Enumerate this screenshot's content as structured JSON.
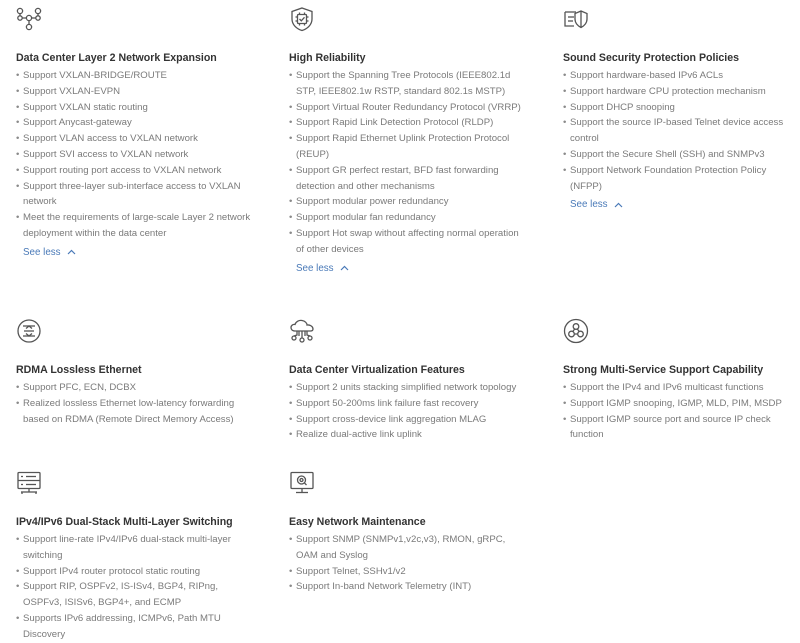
{
  "colors": {
    "title": "#333333",
    "text": "#7a7a7a",
    "link": "#4a7ab8",
    "icon": "#555555"
  },
  "features": [
    {
      "icon": "network-topology-icon",
      "title": "Data Center Layer 2 Network Expansion",
      "items": [
        "Support VXLAN-BRIDGE/ROUTE",
        "Support VXLAN-EVPN",
        "Support VXLAN static routing",
        "Support Anycast-gateway",
        "Support VLAN access to VXLAN network",
        "Support SVI access to VXLAN network",
        "Support routing port access to VXLAN network",
        "Support three-layer sub-interface access to VXLAN network",
        "Meet the requirements of large-scale Layer 2 network deployment within the data center"
      ],
      "toggle": "See less"
    },
    {
      "icon": "shield-chip-icon",
      "title": "High Reliability",
      "items": [
        "Support the Spanning Tree Protocols (IEEE802.1d STP, IEEE802.1w RSTP, standard 802.1s MSTP)",
        "Support Virtual Router Redundancy Protocol (VRRP)",
        "Support Rapid Link Detection Protocol (RLDP)",
        "Support Rapid Ethernet Uplink Protection Protocol (REUP)",
        "Support GR perfect restart, BFD fast forwarding detection and other mechanisms",
        "Support modular power redundancy",
        "Support modular fan redundancy",
        "Support Hot swap without affecting normal operation of other devices"
      ],
      "toggle": "See less"
    },
    {
      "icon": "security-policy-icon",
      "title": "Sound Security Protection Policies",
      "items": [
        "Support hardware-based IPv6 ACLs",
        "Support hardware CPU protection mechanism",
        "Support DHCP snooping",
        "Support the source IP-based Telnet device access control",
        "Support the Secure Shell (SSH) and SNMPv3",
        "Support Network Foundation Protection Policy (NFPP)"
      ],
      "toggle": "See less"
    },
    {
      "icon": "lossless-ethernet-icon",
      "title": "RDMA Lossless Ethernet",
      "items": [
        "Support PFC, ECN, DCBX",
        "Realized lossless Ethernet low-latency forwarding based on RDMA (Remote Direct Memory Access)"
      ]
    },
    {
      "icon": "cloud-network-icon",
      "title": "Data Center Virtualization Features",
      "items": [
        "Support 2 units stacking simplified network topology",
        "Support 50-200ms link failure fast recovery",
        "Support cross-device link aggregation MLAG",
        "Realize dual-active link uplink"
      ]
    },
    {
      "icon": "multi-service-icon",
      "title": "Strong Multi-Service Support Capability",
      "items": [
        "Support the IPv4 and IPv6 multicast functions",
        "Support IGMP snooping, IGMP, MLD, PIM, MSDP",
        "Support IGMP source port and source IP check function"
      ]
    },
    {
      "icon": "server-switch-icon",
      "title": "IPv4/IPv6 Dual-Stack Multi-Layer Switching",
      "items": [
        "Support line-rate IPv4/IPv6 dual-stack multi-layer switching",
        "Support IPv4 router protocol static routing",
        "Support RIP, OSPFv2, IS-ISv4, BGP4, RIPng, OSPFv3, ISISv6, BGP4+, and ECMP",
        "Supports IPv6 addressing, ICMPv6, Path MTU Discovery"
      ]
    },
    {
      "icon": "monitor-maintenance-icon",
      "title": "Easy Network Maintenance",
      "items": [
        "Support SNMP (SNMPv1,v2c,v3), RMON, gRPC, OAM and Syslog",
        "Support Telnet, SSHv1/v2",
        "Support In-band Network Telemetry (INT)"
      ]
    }
  ]
}
